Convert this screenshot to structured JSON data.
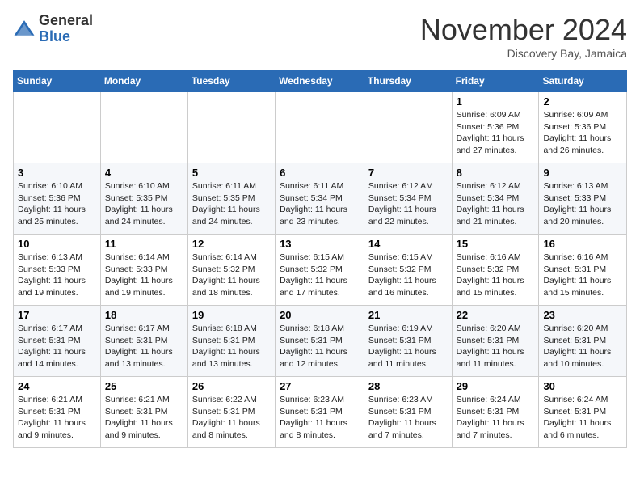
{
  "header": {
    "logo_general": "General",
    "logo_blue": "Blue",
    "month_title": "November 2024",
    "subtitle": "Discovery Bay, Jamaica"
  },
  "days_of_week": [
    "Sunday",
    "Monday",
    "Tuesday",
    "Wednesday",
    "Thursday",
    "Friday",
    "Saturday"
  ],
  "weeks": [
    [
      {
        "day": "",
        "info": ""
      },
      {
        "day": "",
        "info": ""
      },
      {
        "day": "",
        "info": ""
      },
      {
        "day": "",
        "info": ""
      },
      {
        "day": "",
        "info": ""
      },
      {
        "day": "1",
        "info": "Sunrise: 6:09 AM\nSunset: 5:36 PM\nDaylight: 11 hours\nand 27 minutes."
      },
      {
        "day": "2",
        "info": "Sunrise: 6:09 AM\nSunset: 5:36 PM\nDaylight: 11 hours\nand 26 minutes."
      }
    ],
    [
      {
        "day": "3",
        "info": "Sunrise: 6:10 AM\nSunset: 5:36 PM\nDaylight: 11 hours\nand 25 minutes."
      },
      {
        "day": "4",
        "info": "Sunrise: 6:10 AM\nSunset: 5:35 PM\nDaylight: 11 hours\nand 24 minutes."
      },
      {
        "day": "5",
        "info": "Sunrise: 6:11 AM\nSunset: 5:35 PM\nDaylight: 11 hours\nand 24 minutes."
      },
      {
        "day": "6",
        "info": "Sunrise: 6:11 AM\nSunset: 5:34 PM\nDaylight: 11 hours\nand 23 minutes."
      },
      {
        "day": "7",
        "info": "Sunrise: 6:12 AM\nSunset: 5:34 PM\nDaylight: 11 hours\nand 22 minutes."
      },
      {
        "day": "8",
        "info": "Sunrise: 6:12 AM\nSunset: 5:34 PM\nDaylight: 11 hours\nand 21 minutes."
      },
      {
        "day": "9",
        "info": "Sunrise: 6:13 AM\nSunset: 5:33 PM\nDaylight: 11 hours\nand 20 minutes."
      }
    ],
    [
      {
        "day": "10",
        "info": "Sunrise: 6:13 AM\nSunset: 5:33 PM\nDaylight: 11 hours\nand 19 minutes."
      },
      {
        "day": "11",
        "info": "Sunrise: 6:14 AM\nSunset: 5:33 PM\nDaylight: 11 hours\nand 19 minutes."
      },
      {
        "day": "12",
        "info": "Sunrise: 6:14 AM\nSunset: 5:32 PM\nDaylight: 11 hours\nand 18 minutes."
      },
      {
        "day": "13",
        "info": "Sunrise: 6:15 AM\nSunset: 5:32 PM\nDaylight: 11 hours\nand 17 minutes."
      },
      {
        "day": "14",
        "info": "Sunrise: 6:15 AM\nSunset: 5:32 PM\nDaylight: 11 hours\nand 16 minutes."
      },
      {
        "day": "15",
        "info": "Sunrise: 6:16 AM\nSunset: 5:32 PM\nDaylight: 11 hours\nand 15 minutes."
      },
      {
        "day": "16",
        "info": "Sunrise: 6:16 AM\nSunset: 5:31 PM\nDaylight: 11 hours\nand 15 minutes."
      }
    ],
    [
      {
        "day": "17",
        "info": "Sunrise: 6:17 AM\nSunset: 5:31 PM\nDaylight: 11 hours\nand 14 minutes."
      },
      {
        "day": "18",
        "info": "Sunrise: 6:17 AM\nSunset: 5:31 PM\nDaylight: 11 hours\nand 13 minutes."
      },
      {
        "day": "19",
        "info": "Sunrise: 6:18 AM\nSunset: 5:31 PM\nDaylight: 11 hours\nand 13 minutes."
      },
      {
        "day": "20",
        "info": "Sunrise: 6:18 AM\nSunset: 5:31 PM\nDaylight: 11 hours\nand 12 minutes."
      },
      {
        "day": "21",
        "info": "Sunrise: 6:19 AM\nSunset: 5:31 PM\nDaylight: 11 hours\nand 11 minutes."
      },
      {
        "day": "22",
        "info": "Sunrise: 6:20 AM\nSunset: 5:31 PM\nDaylight: 11 hours\nand 11 minutes."
      },
      {
        "day": "23",
        "info": "Sunrise: 6:20 AM\nSunset: 5:31 PM\nDaylight: 11 hours\nand 10 minutes."
      }
    ],
    [
      {
        "day": "24",
        "info": "Sunrise: 6:21 AM\nSunset: 5:31 PM\nDaylight: 11 hours\nand 9 minutes."
      },
      {
        "day": "25",
        "info": "Sunrise: 6:21 AM\nSunset: 5:31 PM\nDaylight: 11 hours\nand 9 minutes."
      },
      {
        "day": "26",
        "info": "Sunrise: 6:22 AM\nSunset: 5:31 PM\nDaylight: 11 hours\nand 8 minutes."
      },
      {
        "day": "27",
        "info": "Sunrise: 6:23 AM\nSunset: 5:31 PM\nDaylight: 11 hours\nand 8 minutes."
      },
      {
        "day": "28",
        "info": "Sunrise: 6:23 AM\nSunset: 5:31 PM\nDaylight: 11 hours\nand 7 minutes."
      },
      {
        "day": "29",
        "info": "Sunrise: 6:24 AM\nSunset: 5:31 PM\nDaylight: 11 hours\nand 7 minutes."
      },
      {
        "day": "30",
        "info": "Sunrise: 6:24 AM\nSunset: 5:31 PM\nDaylight: 11 hours\nand 6 minutes."
      }
    ]
  ]
}
